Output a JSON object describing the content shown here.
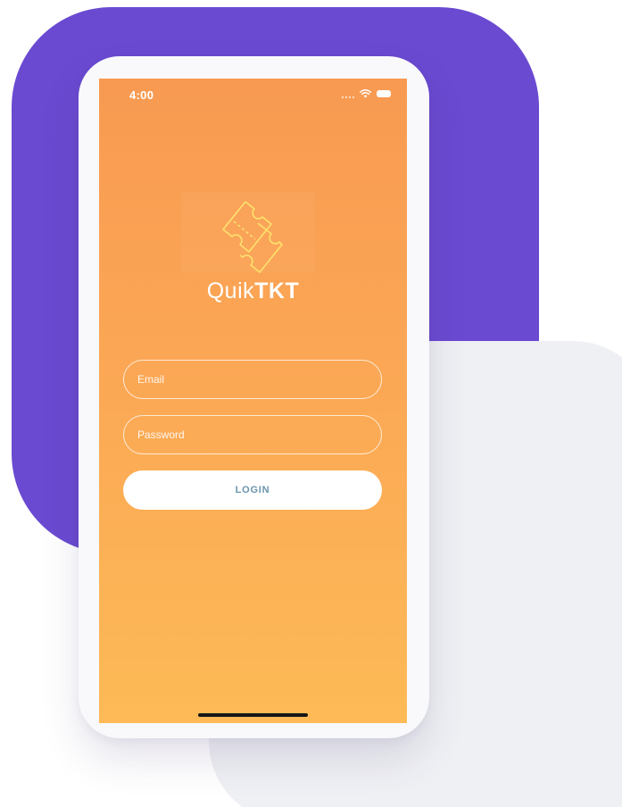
{
  "status_bar": {
    "time": "4:00",
    "icons": [
      "signal-dots-icon",
      "wifi-icon",
      "battery-icon"
    ]
  },
  "brand": {
    "name_light": "Quik",
    "name_bold": "TKT",
    "logo_icon": "ticket-icon"
  },
  "login_form": {
    "email_placeholder": "Email",
    "password_placeholder": "Password",
    "login_label": "LOGIN"
  },
  "colors": {
    "background_blob_purple": "#6a4ad1",
    "background_blob_gray": "#eff0f4",
    "screen_gradient_top": "#f89a52",
    "screen_gradient_bottom": "#fdba56",
    "logo_stroke": "#fde26c",
    "login_text": "#6a94ac"
  }
}
